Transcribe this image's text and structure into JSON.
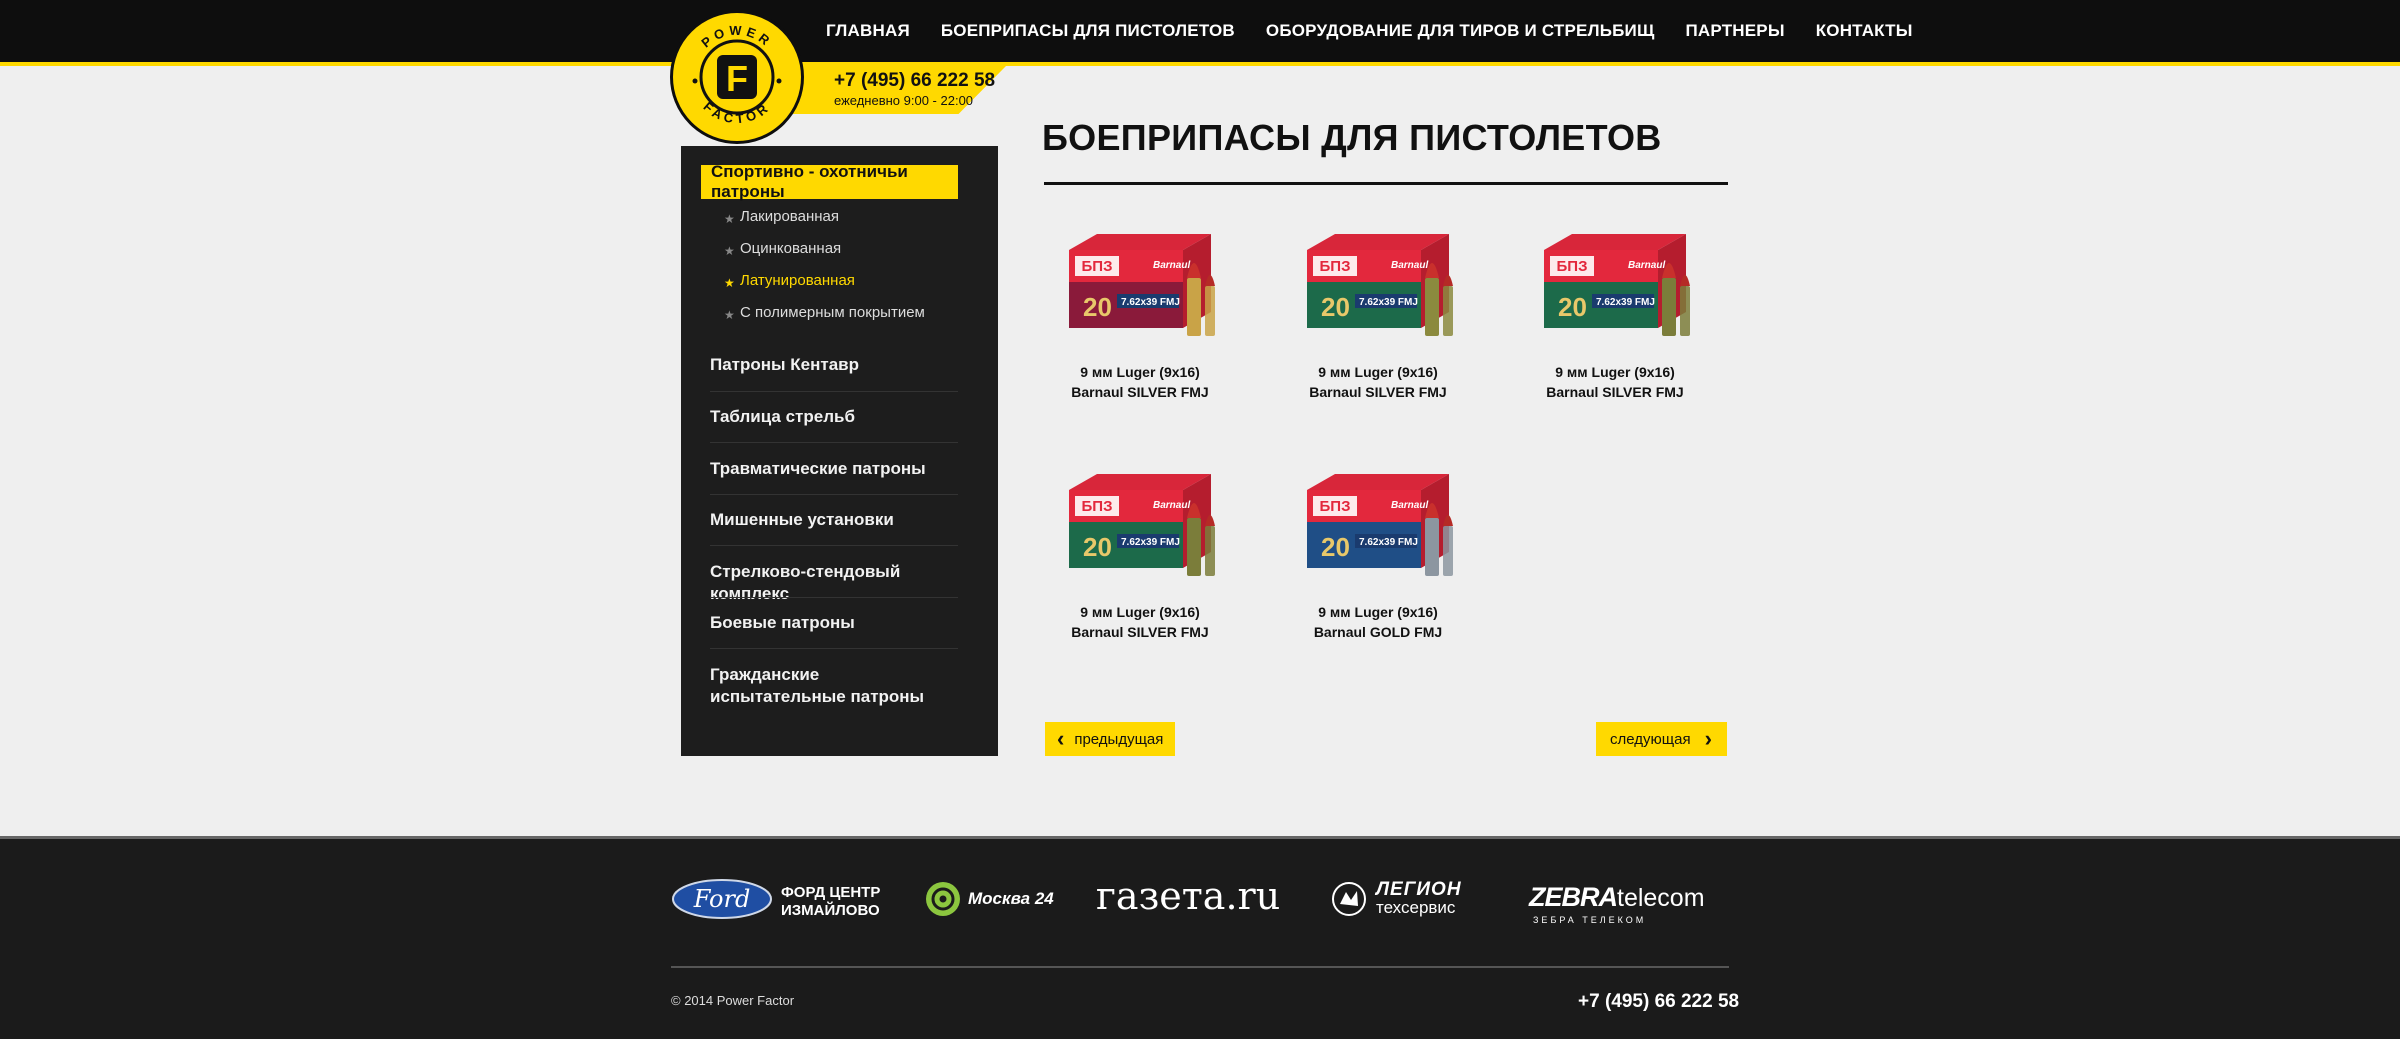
{
  "nav": {
    "items": [
      "ГЛАВНАЯ",
      "БОЕПРИПАСЫ ДЛЯ ПИСТОЛЕТОВ",
      "ОБОРУДОВАНИЕ ДЛЯ ТИРОВ И СТРЕЛЬБИЩ",
      "ПАРТНЕРЫ",
      "КОНТАКТЫ"
    ]
  },
  "header": {
    "phone": "+7 (495) 66 222 58",
    "hours": "ежедневно  9:00 - 22:00",
    "logo_text": "POWER FACTOR",
    "logo_letter": "F"
  },
  "sidebar": {
    "active": "Спортивно - охотничьи патроны",
    "subitems": [
      "Лакированная",
      "Оцинкованная",
      "Латунированная",
      "С полимерным покрытием"
    ],
    "items": [
      "Патроны Кентавр",
      "Таблица стрельб",
      "Травматические патроны",
      "Мишенные установки",
      "Стрелково-стендовый комплекс",
      "Боевые патроны",
      "Гражданские испытательные патроны"
    ]
  },
  "main": {
    "title": "БОЕПРИПАСЫ ДЛЯ ПИСТОЛЕТОВ",
    "products": [
      {
        "line1": "9 мм Luger (9x16)",
        "line2": "Barnaul SILVER FMJ",
        "box_color": "#8a1a3a",
        "bullet": "#c9a347"
      },
      {
        "line1": "9 мм Luger (9x16)",
        "line2": "Barnaul SILVER FMJ",
        "box_color": "#1c6a4a",
        "bullet": "#8b8a3e"
      },
      {
        "line1": "9 мм Luger (9x16)",
        "line2": "Barnaul SILVER FMJ",
        "box_color": "#1c6a4a",
        "bullet": "#7b7d3a"
      },
      {
        "line1": "9 мм Luger (9x16)",
        "line2": "Barnaul SILVER FMJ",
        "box_color": "#1c6a4a",
        "bullet": "#7b7d3a"
      },
      {
        "line1": "9 мм Luger (9x16)",
        "line2": "Barnaul GOLD FMJ",
        "box_color": "#1f4e86",
        "bullet": "#8c96a0"
      }
    ],
    "box_label": "7.62x39 FMJ",
    "box_count": "20",
    "box_brand": "Barnaul",
    "prev": "предыдущая",
    "next": "следующая"
  },
  "footer": {
    "partners": {
      "ford_line1": "ФОРД ЦЕНТР",
      "ford_line2": "ИЗМАЙЛОВО",
      "ford_logo": "Ford",
      "moskva": "Москва 24",
      "gazeta": "газета.ru",
      "legion_line1": "ЛЕГИОН",
      "legion_line2": "техсервис",
      "zebra_bold": "ZEBRA",
      "zebra_light": "telecom",
      "zebra_sub": "ЗЕБРА ТЕЛЕКОМ"
    },
    "copyright": "© 2014 Power Factor",
    "phone": "+7 (495) 66 222 58"
  },
  "colors": {
    "accent": "#ffd900",
    "dark": "#1d1d1d",
    "topbar": "#0e0e0e"
  }
}
